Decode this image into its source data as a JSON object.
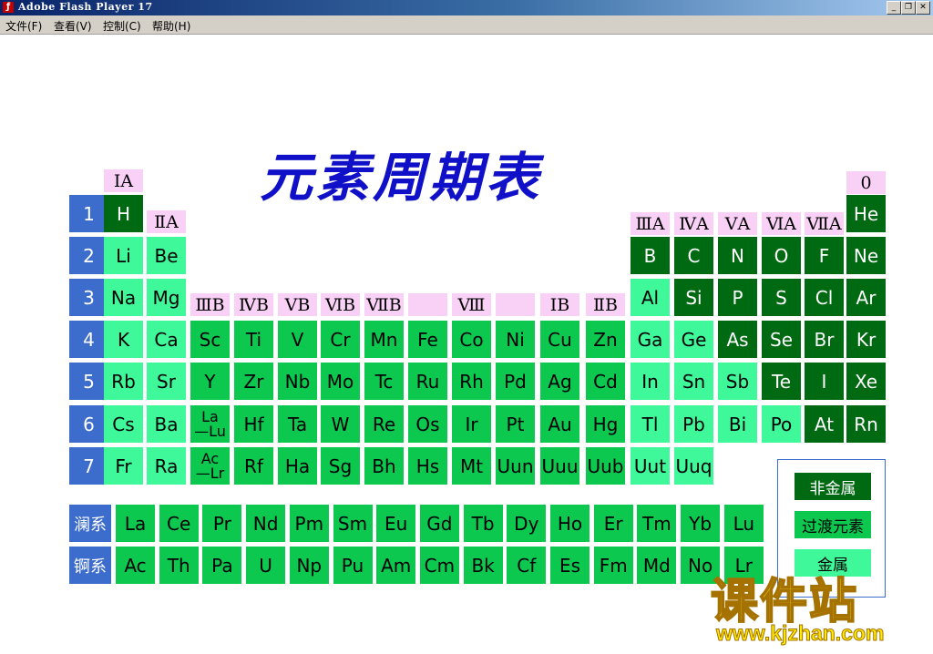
{
  "window": {
    "title": "Adobe Flash Player 17"
  },
  "menu": [
    {
      "label": "文件(F)"
    },
    {
      "label": "查看(V)"
    },
    {
      "label": "控制(C)"
    },
    {
      "label": "帮助(H)"
    }
  ],
  "page_title": "元素周期表",
  "group_labels": {
    "IA": "ⅠA",
    "IIA": "ⅡA",
    "IIIB": "ⅢB",
    "IVB": "ⅣB",
    "VB": "ⅤB",
    "VIB": "ⅥB",
    "VIIB": "ⅦB",
    "VIII": "Ⅷ",
    "IB": "ⅠB",
    "IIB": "ⅡB",
    "IIIA": "ⅢA",
    "IVA": "ⅣA",
    "VA": "ⅤA",
    "VIA": "ⅥA",
    "VIIA": "ⅦA",
    "zero": "0"
  },
  "periods": [
    "1",
    "2",
    "3",
    "4",
    "5",
    "6",
    "7"
  ],
  "series_labels": {
    "lanthanides": "澜系",
    "actinides": "锕系"
  },
  "rows": [
    [
      "H",
      "He"
    ],
    [
      "Li",
      "Be",
      "B",
      "C",
      "N",
      "O",
      "F",
      "Ne"
    ],
    [
      "Na",
      "Mg",
      "Al",
      "Si",
      "P",
      "S",
      "Cl",
      "Ar"
    ],
    [
      "K",
      "Ca",
      "Sc",
      "Ti",
      "V",
      "Cr",
      "Mn",
      "Fe",
      "Co",
      "Ni",
      "Cu",
      "Zn",
      "Ga",
      "Ge",
      "As",
      "Se",
      "Br",
      "Kr"
    ],
    [
      "Rb",
      "Sr",
      "Y",
      "Zr",
      "Nb",
      "Mo",
      "Tc",
      "Ru",
      "Rh",
      "Pd",
      "Ag",
      "Cd",
      "In",
      "Sn",
      "Sb",
      "Te",
      "I",
      "Xe"
    ],
    [
      "Cs",
      "Ba",
      "La\n—Lu",
      "Hf",
      "Ta",
      "W",
      "Re",
      "Os",
      "Ir",
      "Pt",
      "Au",
      "Hg",
      "Tl",
      "Pb",
      "Bi",
      "Po",
      "At",
      "Rn"
    ],
    [
      "Fr",
      "Ra",
      "Ac\n—Lr",
      "Rf",
      "Ha",
      "Sg",
      "Bh",
      "Hs",
      "Mt",
      "Uun",
      "Uuu",
      "Uub",
      "Uut",
      "Uuq"
    ]
  ],
  "lanthanides": [
    "La",
    "Ce",
    "Pr",
    "Nd",
    "Pm",
    "Sm",
    "Eu",
    "Gd",
    "Tb",
    "Dy",
    "Ho",
    "Er",
    "Tm",
    "Yb",
    "Lu"
  ],
  "actinides": [
    "Ac",
    "Th",
    "Pa",
    "U",
    "Np",
    "Pu",
    "Am",
    "Cm",
    "Bk",
    "Cf",
    "Es",
    "Fm",
    "Md",
    "No",
    "Lr"
  ],
  "legend": {
    "nonmetal": "非金属",
    "transition": "过渡元素",
    "metal": "金属"
  },
  "colors": {
    "nonmetal": "#006a12",
    "metal": "#3ff899",
    "transition": "#0dc84f",
    "period": "#3c6ccc",
    "group_bg": "#f9d0f6"
  },
  "watermark": {
    "name": "课件站",
    "url": "www.kjzhan.com"
  }
}
